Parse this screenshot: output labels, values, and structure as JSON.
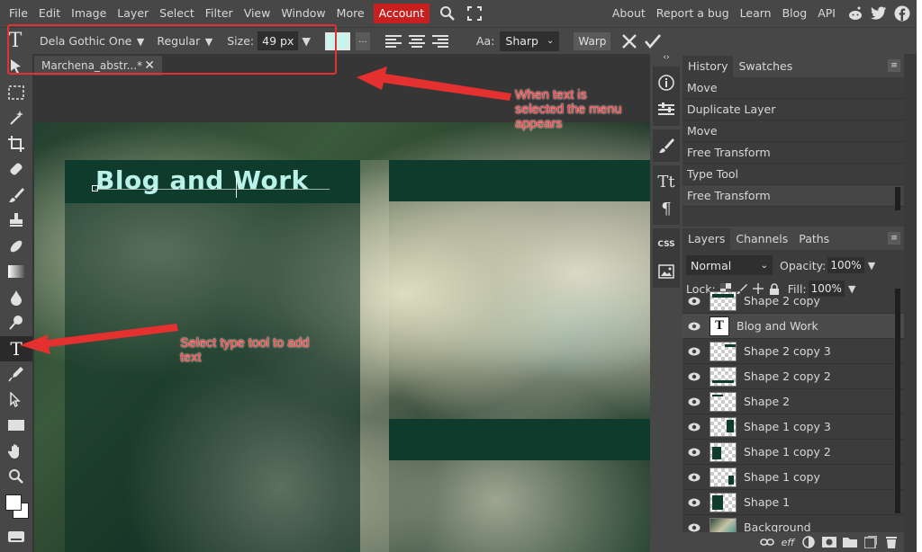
{
  "menu": {
    "items": [
      "File",
      "Edit",
      "Image",
      "Layer",
      "Select",
      "Filter",
      "View",
      "Window",
      "More"
    ],
    "account": "Account",
    "right_items": [
      "About",
      "Report a bug",
      "Learn",
      "Blog",
      "API"
    ]
  },
  "options": {
    "font_family": "Dela Gothic One",
    "font_style": "Regular",
    "size_label": "Size:",
    "size_value": "49 px",
    "text_color": "#c8f4ee",
    "more": "...",
    "aa_label": "Aa:",
    "aa_value": "Sharp",
    "warp": "Warp"
  },
  "document": {
    "tab_title": "Marchena_abstr...*",
    "tab_close": "✕",
    "canvas_text": "Blog and Work"
  },
  "history": {
    "tabs": [
      "History",
      "Swatches"
    ],
    "items": [
      "Move",
      "Duplicate Layer",
      "Move",
      "Free Transform",
      "Type Tool",
      "Free Transform"
    ]
  },
  "layers": {
    "tabs": [
      "Layers",
      "Channels",
      "Paths"
    ],
    "blend_mode": "Normal",
    "opacity_label": "Opacity:",
    "opacity_value": "100%",
    "lock_label": "Lock:",
    "fill_label": "Fill:",
    "fill_value": "100%",
    "list": [
      {
        "name": "Shape 2 copy",
        "kind": "shape"
      },
      {
        "name": "Blog and Work",
        "kind": "text",
        "selected": true
      },
      {
        "name": "Shape 2 copy 3",
        "kind": "shape"
      },
      {
        "name": "Shape 2 copy 2",
        "kind": "shape"
      },
      {
        "name": "Shape 2",
        "kind": "shape"
      },
      {
        "name": "Shape 1 copy 3",
        "kind": "shape"
      },
      {
        "name": "Shape 1 copy 2",
        "kind": "shape"
      },
      {
        "name": "Shape 1 copy",
        "kind": "shape"
      },
      {
        "name": "Shape 1",
        "kind": "shape"
      },
      {
        "name": "Background",
        "kind": "image"
      }
    ],
    "footer_icons": [
      "link-icon",
      "effects-icon",
      "adjustment-icon",
      "mask-icon",
      "folder-icon",
      "new-layer-icon",
      "delete-icon"
    ]
  },
  "annotations": {
    "menu_note": "When text is selected the menu appears",
    "tool_note": "Select type tool to add text",
    "color": "#e53030"
  }
}
